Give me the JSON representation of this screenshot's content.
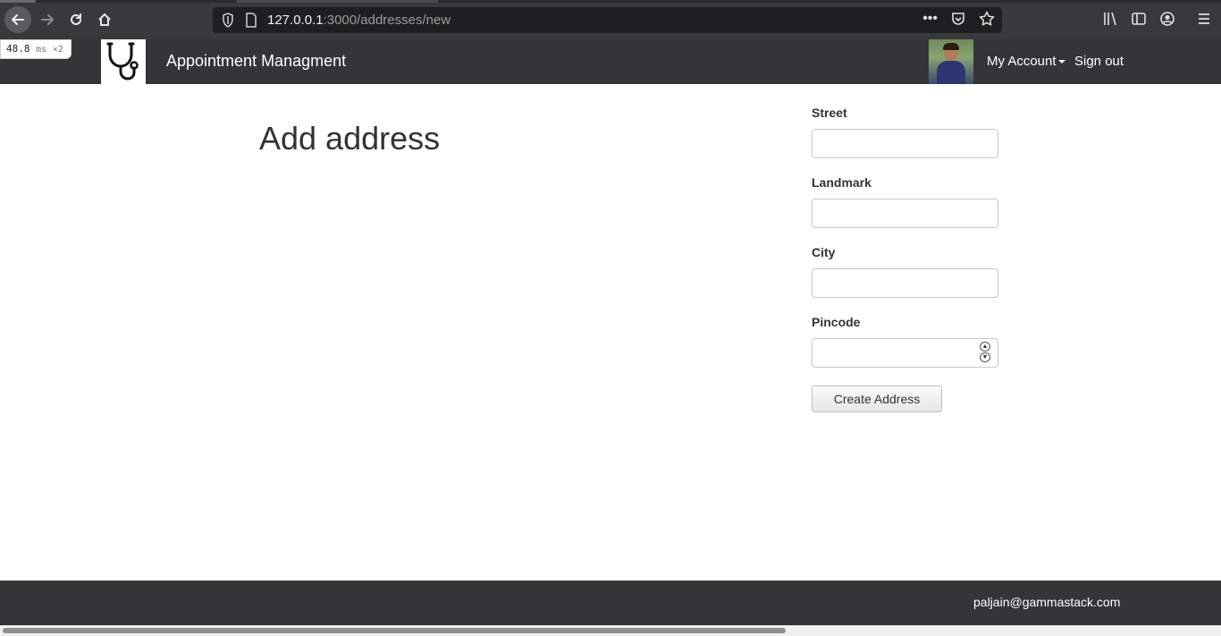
{
  "browser": {
    "url_host": "127.0.0.1",
    "url_path": ":3000/addresses/new",
    "more_icon": "•••",
    "perf_value": "48.8",
    "perf_unit": "ms",
    "perf_count": "×2"
  },
  "navbar": {
    "brand": "Appointment Managment",
    "logo_icon": "stethoscope-icon",
    "my_account": "My Account",
    "sign_out": "Sign out"
  },
  "main": {
    "title": "Add address",
    "form": {
      "fields": [
        {
          "label": "Street",
          "value": ""
        },
        {
          "label": "Landmark",
          "value": ""
        },
        {
          "label": "City",
          "value": ""
        },
        {
          "label": "Pincode",
          "value": ""
        }
      ],
      "submit_label": "Create Address"
    }
  },
  "footer": {
    "email": "paljain@gammastack.com"
  },
  "colors": {
    "navbar_bg": "#323637",
    "text": "#333333"
  }
}
